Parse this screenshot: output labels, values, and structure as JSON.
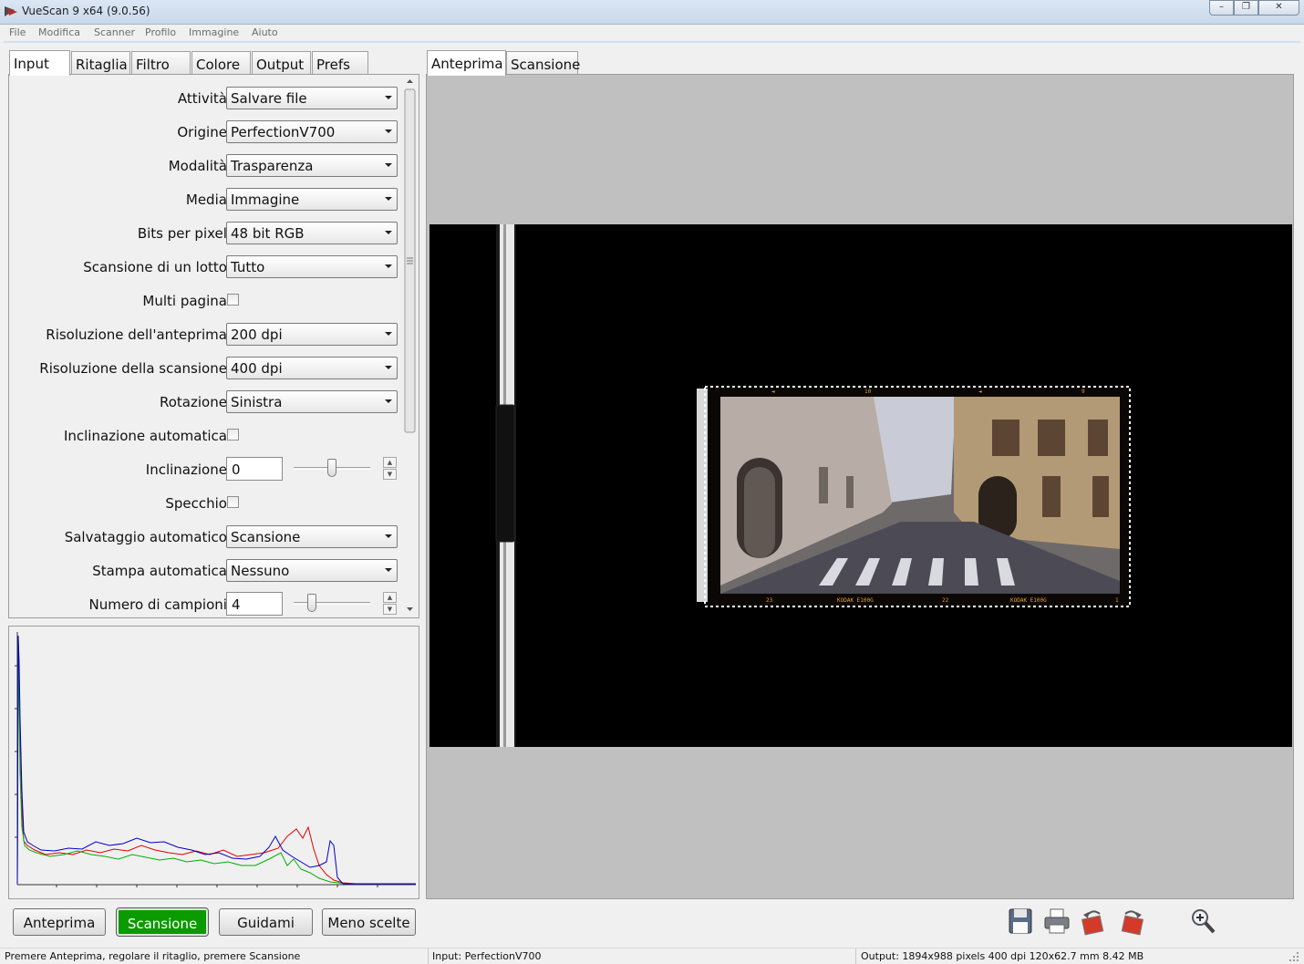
{
  "window": {
    "title": "VueScan 9 x64 (9.0.56)",
    "buttons": [
      "–",
      "❐",
      "✕"
    ]
  },
  "menu": [
    "File",
    "Modifica",
    "Scanner",
    "Profilo",
    "Immagine",
    "Aiuto"
  ],
  "left_tabs": [
    "Input",
    "Ritaglia",
    "Filtro",
    "Colore",
    "Output",
    "Prefs"
  ],
  "right_tabs": [
    "Anteprima",
    "Scansione"
  ],
  "settings": {
    "attivita": {
      "label": "Attività:",
      "value": "Salvare file"
    },
    "origine": {
      "label": "Origine:",
      "value": "PerfectionV700"
    },
    "modalita": {
      "label": "Modalità:",
      "value": "Trasparenza"
    },
    "media": {
      "label": "Media:",
      "value": "Immagine"
    },
    "bits": {
      "label": "Bits per pixel:",
      "value": "48 bit RGB"
    },
    "lotto": {
      "label": "Scansione di un lotto:",
      "value": "Tutto"
    },
    "multi": {
      "label": "Multi pagina:",
      "checked": false
    },
    "ris_anteprima": {
      "label": "Risoluzione dell'anteprima:",
      "value": "200 dpi"
    },
    "ris_scansione": {
      "label": "Risoluzione della scansione:",
      "value": "400 dpi"
    },
    "rotazione": {
      "label": "Rotazione:",
      "value": "Sinistra"
    },
    "incl_auto": {
      "label": "Inclinazione automatica:",
      "checked": false
    },
    "inclinazione": {
      "label": "Inclinazione:",
      "value": "0"
    },
    "specchio": {
      "label": "Specchio:",
      "checked": false
    },
    "salv_auto": {
      "label": "Salvataggio automatico:",
      "value": "Scansione"
    },
    "stampa_auto": {
      "label": "Stampa automatica:",
      "value": "Nessuno"
    },
    "campioni": {
      "label": "Numero di campioni:",
      "value": "4"
    }
  },
  "buttons": {
    "anteprima": "Anteprima",
    "scansione": "Scansione",
    "guidami": "Guidami",
    "meno": "Meno scelte"
  },
  "status": {
    "left": "Premere Anteprima, regolare il ritaglio, premere Scansione",
    "middle": "Input: PerfectionV700",
    "right": "Output: 1894x988 pixels 400 dpi 120x62.7 mm 8.42 MB"
  },
  "film_edge_text": [
    "◄",
    "10",
    "◄",
    "9",
    "23",
    "KODAK E100G",
    "22",
    "KODAK E100G",
    "1"
  ],
  "toolbar_icons": [
    "save-icon",
    "print-icon",
    "rotate-left-icon",
    "rotate-right-icon",
    "zoom-icon"
  ],
  "colors": {
    "scan_button": "#0b9a00",
    "preview_bg": "#c0c0c0"
  }
}
